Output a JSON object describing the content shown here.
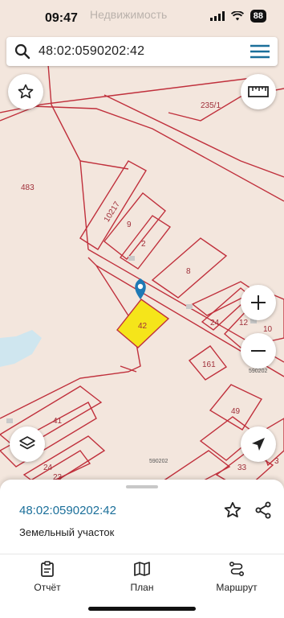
{
  "status_bar": {
    "time": "09:47",
    "watermark": "Недвижимость",
    "battery": "88",
    "icons": [
      "signal-icon",
      "wifi-icon",
      "battery-icon"
    ]
  },
  "search": {
    "value": "48:02:0590202:42",
    "icon": "search-icon",
    "menu_icon": "hamburger-menu-icon"
  },
  "map": {
    "labels": {
      "p235": "235/1",
      "p483": "483",
      "p10217": "10217",
      "p9": "9",
      "p2": "2",
      "p8": "8",
      "p42": "42",
      "p24": "24",
      "p12": "12",
      "p10": "10",
      "p161": "161",
      "p49": "49",
      "p41": "41",
      "p24b": "24",
      "p23": "23",
      "p33": "33",
      "p3": "3",
      "q590202a": "590202",
      "q590202b": "590202"
    },
    "colors": {
      "background": "#f3e6dd",
      "parcel_line": "#c0303c",
      "selected_fill": "#f5e51a",
      "water": "#cfe6ef",
      "marker": "#1f79b5"
    },
    "controls": [
      "favorite-star-icon",
      "ruler-icon",
      "zoom-in-icon",
      "zoom-out-icon",
      "layers-icon",
      "navigation-arrow-icon"
    ]
  },
  "sheet": {
    "cadastral_number": "48:02:0590202:42",
    "object_type": "Земельный участок",
    "actions": [
      "star-icon",
      "share-icon"
    ]
  },
  "tabs": [
    {
      "label": "Отчёт",
      "icon": "report-clipboard-icon"
    },
    {
      "label": "План",
      "icon": "map-plan-icon"
    },
    {
      "label": "Маршрут",
      "icon": "route-icon"
    }
  ]
}
